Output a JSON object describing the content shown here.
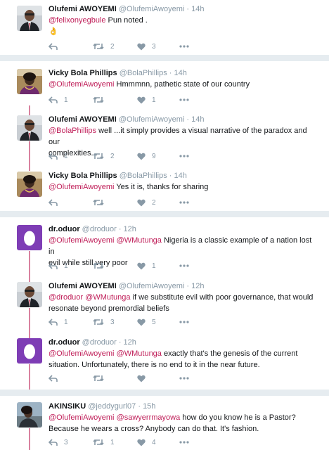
{
  "tweets": [
    {
      "name": "Olufemi AWOYEMI",
      "handle": "@OlufemiAwoyemi",
      "sep": " · ",
      "time": "14h",
      "mention1": "@felixonyegbule",
      "mention2": "",
      "line1": " Pun noted .",
      "line2": "👌",
      "counts": {
        "reply": "",
        "retweet": "2",
        "like": "3"
      }
    },
    {
      "name": "Vicky Bola Phillips",
      "handle": "@BolaPhillips",
      "sep": " · ",
      "time": "14h",
      "mention1": "@OlufemiAwoyemi",
      "mention2": "",
      "line1": "  Hmmmnn, pathetic state of our country",
      "line2": "",
      "counts": {
        "reply": "1",
        "retweet": "",
        "like": "1"
      }
    },
    {
      "name": "Olufemi AWOYEMI",
      "handle": "@OlufemiAwoyemi",
      "sep": " · ",
      "time": "14h",
      "mention1": "@BolaPhillips",
      "mention2": "",
      "line1": " well ...it simply  provides a visual narrative of the paradox and our",
      "line2": "complexities...",
      "counts": {
        "reply": "1",
        "retweet": "2",
        "like": "9"
      }
    },
    {
      "name": "Vicky Bola Phillips",
      "handle": "@BolaPhillips",
      "sep": " · ",
      "time": "14h",
      "mention1": "@OlufemiAwoyemi",
      "mention2": "",
      "line1": "  Yes it is, thanks for sharing",
      "line2": "",
      "counts": {
        "reply": "",
        "retweet": "",
        "like": "2"
      }
    },
    {
      "name": "dr.oduor",
      "handle": "@droduor",
      "sep": " · ",
      "time": "12h",
      "mention1": "@OlufemiAwoyemi",
      "mention2": "@WMutunga",
      "line1": " Nigeria is a classic example of a nation lost in",
      "line2": "evil while still very poor",
      "counts": {
        "reply": "1",
        "retweet": "",
        "like": "1"
      }
    },
    {
      "name": "Olufemi AWOYEMI",
      "handle": "@OlufemiAwoyemi",
      "sep": " · ",
      "time": "12h",
      "mention1": "@droduor",
      "mention2": "@WMutunga",
      "line1": " if we substitute evil with poor governance, that would",
      "line2": "resonate beyond premordial beliefs",
      "counts": {
        "reply": "1",
        "retweet": "3",
        "like": "5"
      }
    },
    {
      "name": "dr.oduor",
      "handle": "@droduor",
      "sep": " · ",
      "time": "12h",
      "mention1": "@OlufemiAwoyemi",
      "mention2": "@WMutunga",
      "line1": " exactly that's the genesis of the current",
      "line2": "situation. Unfortunately, there is no end to it in the near future.",
      "counts": {
        "reply": "",
        "retweet": "",
        "like": ""
      }
    },
    {
      "name": "AKINSIKU",
      "handle": "@jeddygurl07",
      "sep": " · ",
      "time": "15h",
      "mention1": "@OlufemiAwoyemi",
      "mention2": "@sawyerrmayowa",
      "line1": " how do you know he is a Pastor?",
      "line2": "Because he wears a cross? Anybody can do that. It's fashion.",
      "counts": {
        "reply": "3",
        "retweet": "1",
        "like": "4"
      }
    }
  ],
  "icons": [
    "reply-icon",
    "retweet-icon",
    "heart-icon",
    "more-icon"
  ],
  "colors": {
    "mention": "#c0205a",
    "thread": "#d9829f",
    "meta": "#8899a6",
    "background": "#e6ecf0"
  }
}
